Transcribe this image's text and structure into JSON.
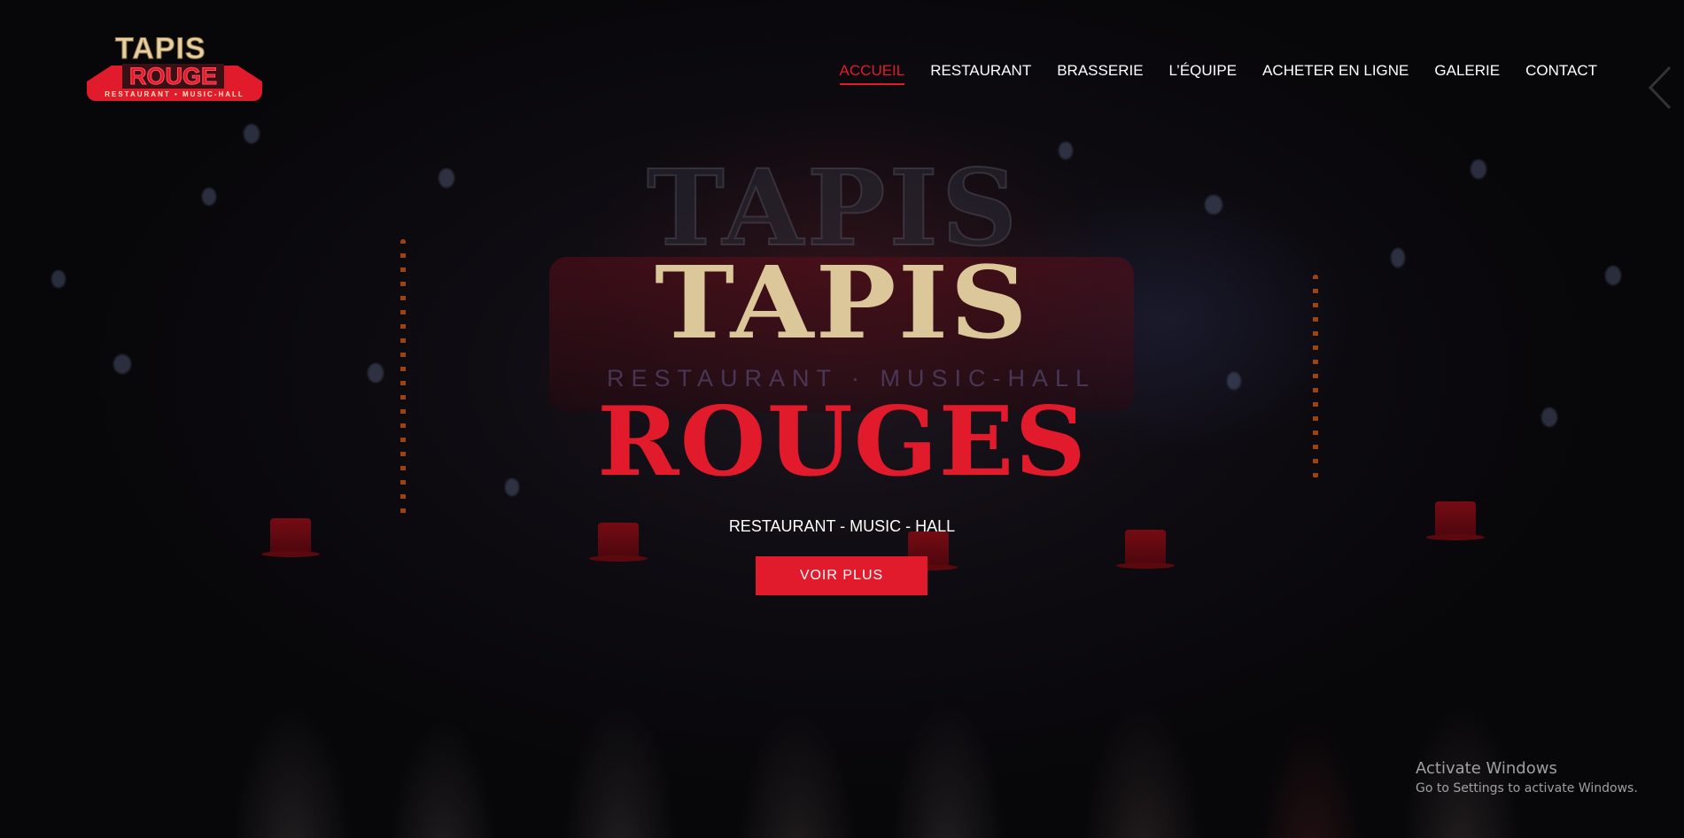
{
  "header": {
    "logo": {
      "line1": "TAPIS",
      "line2": "ROUGE",
      "tagline": "RESTAURANT • MUSIC-HALL"
    },
    "nav": [
      {
        "label": "ACCUEIL",
        "active": true
      },
      {
        "label": "RESTAURANT",
        "active": false
      },
      {
        "label": "BRASSERIE",
        "active": false
      },
      {
        "label": "L’ÉQUIPE",
        "active": false
      },
      {
        "label": "ACHETER EN LIGNE",
        "active": false
      },
      {
        "label": "GALERIE",
        "active": false
      },
      {
        "label": "CONTACT",
        "active": false
      }
    ],
    "slider_arrow_icon": "chevron-left-icon"
  },
  "hero": {
    "background_sign_text": "TAPIS",
    "background_stage_text": "RESTAURANT · MUSIC-HALL",
    "title_top": "TAPIS",
    "title_bottom": "ROUGES",
    "subtitle": "RESTAURANT - MUSIC - HALL",
    "cta_label": "VOIR PLUS"
  },
  "watermark": {
    "title": "Activate Windows",
    "subtitle": "Go to Settings to activate Windows."
  },
  "colors": {
    "accent_red": "#e21b2c",
    "title_gold": "#dcc79a",
    "nav_text": "#ffffff",
    "background": "#0b0a0c"
  }
}
